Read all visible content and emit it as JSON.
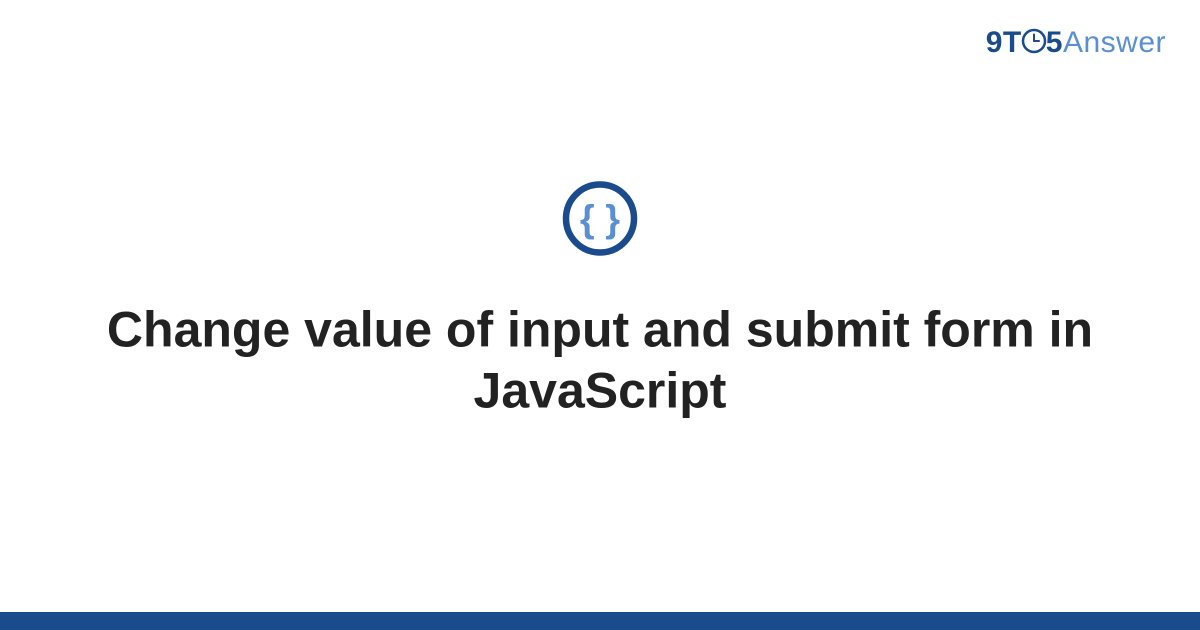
{
  "logo": {
    "part1": "9T",
    "part2": "5",
    "part3": "Answer"
  },
  "icon_name": "braces-icon",
  "title": "Change value of input and submit form in JavaScript",
  "colors": {
    "brand_dark": "#1a4b8c",
    "brand_light": "#5a8fd4",
    "text": "#222222",
    "background": "#ffffff"
  }
}
